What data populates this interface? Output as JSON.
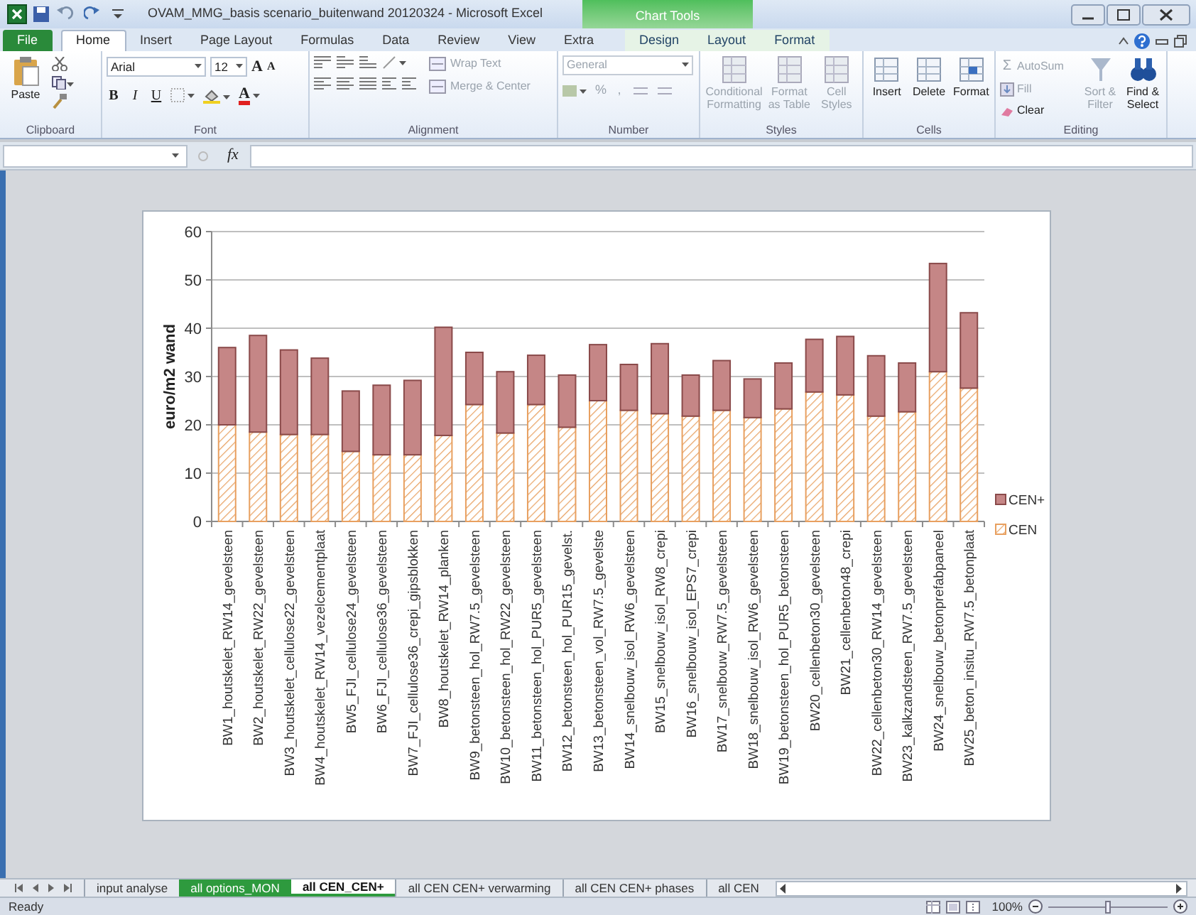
{
  "window": {
    "title": "OVAM_MMG_basis scenario_buitenwand 20120324  -  Microsoft Excel",
    "contextual_label": "Chart Tools"
  },
  "ribbon_tabs": [
    {
      "label": "File",
      "selected": false,
      "contextual": false
    },
    {
      "label": "Home",
      "selected": true,
      "contextual": false
    },
    {
      "label": "Insert",
      "selected": false,
      "contextual": false
    },
    {
      "label": "Page Layout",
      "selected": false,
      "contextual": false
    },
    {
      "label": "Formulas",
      "selected": false,
      "contextual": false
    },
    {
      "label": "Data",
      "selected": false,
      "contextual": false
    },
    {
      "label": "Review",
      "selected": false,
      "contextual": false
    },
    {
      "label": "View",
      "selected": false,
      "contextual": false
    },
    {
      "label": "Extra",
      "selected": false,
      "contextual": false
    },
    {
      "label": "Design",
      "selected": false,
      "contextual": true
    },
    {
      "label": "Layout",
      "selected": false,
      "contextual": true
    },
    {
      "label": "Format",
      "selected": false,
      "contextual": true
    }
  ],
  "clipboard": {
    "label": "Clipboard",
    "paste": "Paste"
  },
  "font": {
    "label": "Font",
    "font_name": "Arial",
    "font_size": "12",
    "size_buttons": [
      "A",
      "A"
    ],
    "style_buttons": [
      "B",
      "I",
      "U"
    ],
    "color_button": "A"
  },
  "alignment": {
    "label": "Alignment",
    "buttons": [
      {
        "label": "Wrap Text",
        "disabled": true
      },
      {
        "label": "Merge & Center",
        "disabled": true
      }
    ]
  },
  "number": {
    "label": "Number",
    "format": "General",
    "symbols": [
      "%",
      ","
    ],
    "disabled": true
  },
  "styles": {
    "label": "Styles",
    "buttons": [
      {
        "label": "Conditional Formatting",
        "disabled": true
      },
      {
        "label": "Format as Table",
        "disabled": true
      },
      {
        "label": "Cell Styles",
        "disabled": true
      }
    ]
  },
  "cells": {
    "label": "Cells",
    "buttons": [
      {
        "label": "Insert",
        "disabled": false
      },
      {
        "label": "Delete",
        "disabled": false
      },
      {
        "label": "Format",
        "disabled": false
      }
    ]
  },
  "editing": {
    "label": "Editing",
    "small": [
      {
        "icon": "Σ",
        "label": "AutoSum",
        "disabled": true
      },
      {
        "label": "Fill",
        "disabled": true
      },
      {
        "label": "Clear",
        "disabled": false
      }
    ],
    "large": [
      {
        "label": "Sort & Filter",
        "disabled": true
      },
      {
        "label": "Find & Select",
        "disabled": false
      }
    ]
  },
  "formula_bar": {
    "fx": "fx"
  },
  "chart_data": {
    "type": "bar",
    "stacked": true,
    "grid": true,
    "legend": true,
    "ylabel": "euro/m2 wand",
    "ylim": [
      0,
      60
    ],
    "yticks": [
      0,
      10,
      20,
      30,
      40,
      50,
      60
    ],
    "categories": [
      "BW1_houtskelet_RW14_gevelsteen",
      "BW2_houtskelet_RW22_gevelsteen",
      "BW3_houtskelet_cellulose22_gevelsteen",
      "BW4_houtskelet_RW14_vezelcementplaat",
      "BW5_FJI_cellulose24_gevelsteen",
      "BW6_FJI_cellulose36_gevelsteen",
      "BW7_FJI_cellulose36_crepi_gipsblokken",
      "BW8_houtskelet_RW14_planken",
      "BW9_betonsteen_hol_RW7.5_gevelsteen",
      "BW10_betonsteen_hol_RW22_gevelsteen",
      "BW11_betonsteen_hol_PUR5_gevelsteen",
      "BW12_betonsteen_hol_PUR15_gevelst.",
      "BW13_betonsteen_vol_RW7.5_gevelste",
      "BW14_snelbouw_isol_RW6_gevelsteen",
      "BW15_snelbouw_isol_RW8_crepi",
      "BW16_snelbouw_isol_EPS7_crepi",
      "BW17_snelbouw_RW7.5_gevelsteen",
      "BW18_snelbouw_isol_RW6_gevelsteen",
      "BW19_betonsteen_hol_PUR5_betonsteen",
      "BW20_cellenbeton30_gevelsteen",
      "BW21_cellenbeton48_crepi",
      "BW22_cellenbeton30_RW14_gevelsteen",
      "BW23_kalkzandsteen_RW7.5_gevelsteen",
      "BW24_snelbouw_betonprefabpaneel",
      "BW25_beton_insitu_RW7.5_betonplaat"
    ],
    "series": [
      {
        "name": "CEN",
        "color": "#e8a060",
        "values": [
          20,
          18.5,
          18,
          18,
          14.5,
          13.8,
          13.8,
          17.8,
          24.2,
          18.3,
          24.2,
          19.5,
          25,
          23,
          22.3,
          21.8,
          23,
          21.5,
          23.3,
          26.8,
          26.2,
          21.8,
          22.7,
          31,
          27.6
        ]
      },
      {
        "name": "CEN+",
        "color": "#c58686",
        "values": [
          16,
          20,
          17.5,
          15.8,
          12.5,
          14.4,
          15.4,
          22.4,
          10.8,
          12.7,
          10.2,
          10.8,
          11.6,
          9.5,
          14.5,
          8.5,
          10.3,
          8,
          9.5,
          10.9,
          12.1,
          12.5,
          10.1,
          22.4,
          15.6
        ]
      }
    ]
  },
  "sheet_tabs": [
    {
      "label": "input analyse",
      "selected": false
    },
    {
      "label": "all options_MON",
      "selected": false,
      "color": "#2e9a3e"
    },
    {
      "label": "all CEN_CEN+",
      "selected": true
    },
    {
      "label": "all CEN CEN+ verwarming",
      "selected": false
    },
    {
      "label": "all CEN CEN+ phases",
      "selected": false
    },
    {
      "label": "all CEN",
      "selected": false
    }
  ],
  "status_bar": {
    "status": "Ready",
    "zoom": "100%",
    "zoom_slider": {
      "level": 0.5
    }
  }
}
